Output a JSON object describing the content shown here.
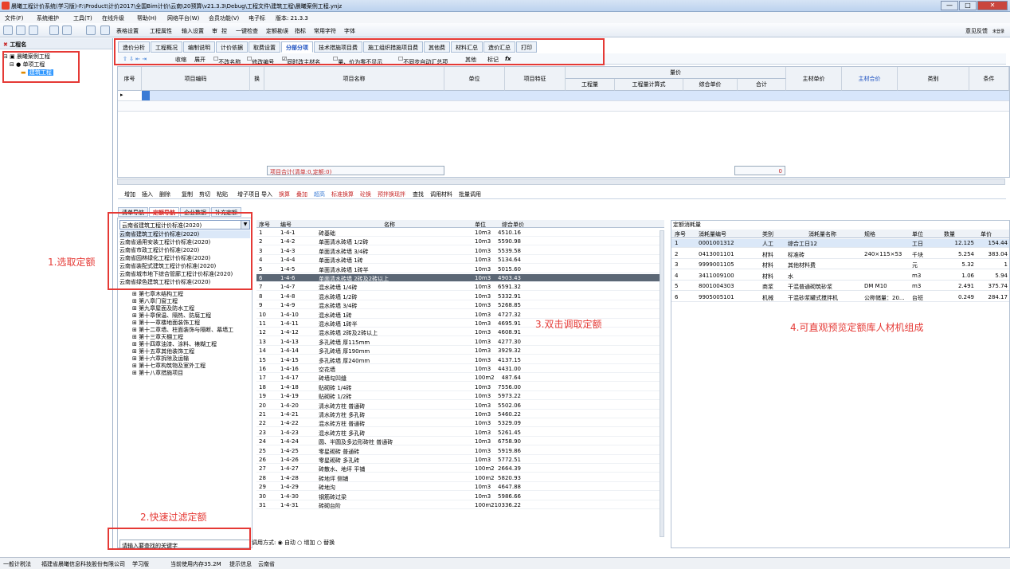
{
  "title": "晨曦工程计价系统(学习版)-F:\\Product\\计价2017\\全国Bim计价\\云南\\20预算\\v21.3.3\\Debug\\工程文件\\建筑工程\\晨曦案例工程.ynjz",
  "window_buttons": [
    "—",
    "□",
    "✕"
  ],
  "menu": [
    "文件(F)",
    "系统维护",
    "工具(T)",
    "在线升级",
    "帮助(H)",
    "网络平台(W)",
    "会员功能(V)",
    "电子标",
    "版本: 21.3.3"
  ],
  "toolbar": [
    "表格设置",
    "工程属性",
    "输入设置",
    "审",
    "控",
    "一键检查",
    "定额勘误",
    "指标",
    "常用字符",
    "字体"
  ],
  "feedback": "意见反馈",
  "user_label": "未登录",
  "left_header": "工程名",
  "tree": [
    "晨曦案例工程",
    "单项工程",
    "建筑工程"
  ],
  "tabs": [
    "造价分析",
    "工程概况",
    "编制说明",
    "计价依据",
    "取费设置",
    "分部分项",
    "技术措施项目费",
    "施工组织措施项目费",
    "其他费",
    "材料汇总",
    "造价汇总",
    "打印"
  ],
  "active_tab": "分部分项",
  "subtools": [
    "收缩",
    "展开",
    "不改名称",
    "修改编号",
    "同时改主材名",
    "量、价为零不显示",
    "不同步自动汇总项",
    "其他",
    "标记",
    "fx"
  ],
  "grid_headers": {
    "seq": "序号",
    "code": "项目编码",
    "swap": "换",
    "name": "项目名称",
    "unit": "单位",
    "feature": "项目特征",
    "qty_price": "量价",
    "qty": "工程量",
    "qty_formula": "工程量计算式",
    "unit_price": "综合单价",
    "total": "合计",
    "main_price": "主材单价",
    "main_total": "主材合价",
    "category": "类别",
    "clause": "条件"
  },
  "row_marker": "▸",
  "sum_label": "项目合计(清单:0,定额:0)",
  "sum_value": "0",
  "ops": [
    "增加",
    "插入",
    "删除",
    "复制",
    "剪切",
    "粘贴",
    "增子项目",
    "导入",
    "换算",
    "叠加",
    "超高",
    "标准换算",
    "砼换",
    "预拌换现拌",
    "查找",
    "调用材料",
    "批量调用"
  ],
  "bottom_tabs": [
    "清单导航",
    "定额导航",
    "企业数据",
    "补充定额"
  ],
  "lib_selected": "云南省建筑工程计价标准(2020)",
  "lib_options": [
    "云南省建筑工程计价标准(2020)",
    "云南省通用安装工程计价标准(2020)",
    "云南省市政工程计价标准(2020)",
    "云南省园林绿化工程计价标准(2020)",
    "云南省装配式建筑工程计价标准(2020)",
    "云南省城市地下综合管廊工程计价标准(2020)",
    "云南省绿色建筑工程计价标准(2020)"
  ],
  "chapters": [
    "第七章木结构工程",
    "第八章门窗工程",
    "第九章屋面及防水工程",
    "第十章保温、隔热、防腐工程",
    "第十一章楼地面装饰工程",
    "第十二章墙、柱面装饰与隔断、幕墙工",
    "第十三章天棚工程",
    "第十四章油漆、涂料、裱糊工程",
    "第十五章其他装饰工程",
    "第十六章拆除及运输",
    "第十七章构筑物及室外工程",
    "第十八章措施项目"
  ],
  "search_placeholder": "请输入要查找的关键字",
  "quota_headers": [
    "序号",
    "编号",
    "名称",
    "单位",
    "综合单价"
  ],
  "quotas": [
    [
      "1",
      "1-4-1",
      "砖基础",
      "10m3",
      "4510.16"
    ],
    [
      "2",
      "1-4-2",
      "单面清水砖墙 1/2砖",
      "10m3",
      "5590.98"
    ],
    [
      "3",
      "1-4-3",
      "单面清水砖墙 3/4砖",
      "10m3",
      "5539.58"
    ],
    [
      "4",
      "1-4-4",
      "单面清水砖墙 1砖",
      "10m3",
      "5134.64"
    ],
    [
      "5",
      "1-4-5",
      "单面清水砖墙 1砖半",
      "10m3",
      "5015.60"
    ],
    [
      "6",
      "1-4-6",
      "单面清水砖墙 2砖及2砖以上",
      "10m3",
      "4903.43"
    ],
    [
      "7",
      "1-4-7",
      "混水砖墙 1/4砖",
      "10m3",
      "6591.32"
    ],
    [
      "8",
      "1-4-8",
      "混水砖墙 1/2砖",
      "10m3",
      "5332.91"
    ],
    [
      "9",
      "1-4-9",
      "混水砖墙 3/4砖",
      "10m3",
      "5268.85"
    ],
    [
      "10",
      "1-4-10",
      "混水砖墙 1砖",
      "10m3",
      "4727.32"
    ],
    [
      "11",
      "1-4-11",
      "混水砖墙 1砖半",
      "10m3",
      "4695.91"
    ],
    [
      "12",
      "1-4-12",
      "混水砖墙 2砖及2砖以上",
      "10m3",
      "4608.91"
    ],
    [
      "13",
      "1-4-13",
      "多孔砖墙 厚115mm",
      "10m3",
      "4277.30"
    ],
    [
      "14",
      "1-4-14",
      "多孔砖墙 厚190mm",
      "10m3",
      "3929.32"
    ],
    [
      "15",
      "1-4-15",
      "多孔砖墙 厚240mm",
      "10m3",
      "4137.15"
    ],
    [
      "16",
      "1-4-16",
      "空花墙",
      "10m3",
      "4431.00"
    ],
    [
      "17",
      "1-4-17",
      "砖墙勾凹缝",
      "100m2",
      "487.64"
    ],
    [
      "18",
      "1-4-18",
      "贴砌砖 1/4砖",
      "10m3",
      "7556.00"
    ],
    [
      "19",
      "1-4-19",
      "贴砌砖 1/2砖",
      "10m3",
      "5973.22"
    ],
    [
      "20",
      "1-4-20",
      "清水砖方柱 普通砖",
      "10m3",
      "5502.06"
    ],
    [
      "21",
      "1-4-21",
      "清水砖方柱 多孔砖",
      "10m3",
      "5460.22"
    ],
    [
      "22",
      "1-4-22",
      "混水砖方柱 普通砖",
      "10m3",
      "5329.09"
    ],
    [
      "23",
      "1-4-23",
      "混水砖方柱 多孔砖",
      "10m3",
      "5261.45"
    ],
    [
      "24",
      "1-4-24",
      "圆、半圆及多边形砖柱 普通砖",
      "10m3",
      "6758.90"
    ],
    [
      "25",
      "1-4-25",
      "零星砌砖 普通砖",
      "10m3",
      "5919.86"
    ],
    [
      "26",
      "1-4-26",
      "零星砌砖 多孔砖",
      "10m3",
      "5772.51"
    ],
    [
      "27",
      "1-4-27",
      "砖散水、地坪 平铺",
      "100m2",
      "2664.39"
    ],
    [
      "28",
      "1-4-28",
      "砖地坪 侧铺",
      "100m2",
      "5820.93"
    ],
    [
      "29",
      "1-4-29",
      "砖地沟",
      "10m3",
      "4647.88"
    ],
    [
      "30",
      "1-4-30",
      "钢筋砖过梁",
      "10m3",
      "5986.66"
    ],
    [
      "31",
      "1-4-31",
      "砖砌台阶",
      "100m2",
      "10336.22"
    ]
  ],
  "mode_label": "调用方式:",
  "mode_options": [
    "自动",
    "增加",
    "替换"
  ],
  "right_title": "定额消耗量",
  "res_headers": [
    "序号",
    "消耗量编号",
    "类别",
    "消耗量名称",
    "规格",
    "单位",
    "数量",
    "单价"
  ],
  "resources": [
    [
      "1",
      "0001001312",
      "人工",
      "综合工日12",
      "",
      "工日",
      "12.125",
      "154.44"
    ],
    [
      "2",
      "0413001101",
      "材料",
      "标准砖",
      "240×115×53",
      "千块",
      "5.254",
      "383.04"
    ],
    [
      "3",
      "9999001105",
      "材料",
      "其他材料费",
      "",
      "元",
      "5.32",
      "1"
    ],
    [
      "4",
      "3411009100",
      "材料",
      "水",
      "",
      "m3",
      "1.06",
      "5.94"
    ],
    [
      "5",
      "8001004303",
      "商浆",
      "干混普通砌筑砂浆",
      "DM M10",
      "m3",
      "2.491",
      "375.74"
    ],
    [
      "6",
      "9905005101",
      "机械",
      "干混砂浆罐式搅拌机",
      "公称储量：20...",
      "台班",
      "0.249",
      "284.17"
    ]
  ],
  "annotations": [
    "1.选取定额",
    "2.快速过滤定额",
    "3.双击调取定额",
    "4.可直观预览定额库人材机组成"
  ],
  "status": [
    "一般计税法",
    "福建省晨曦信息科技股份有限公司",
    "学习版",
    "当前使用内存35.2M",
    "提示信息",
    "云南省"
  ]
}
